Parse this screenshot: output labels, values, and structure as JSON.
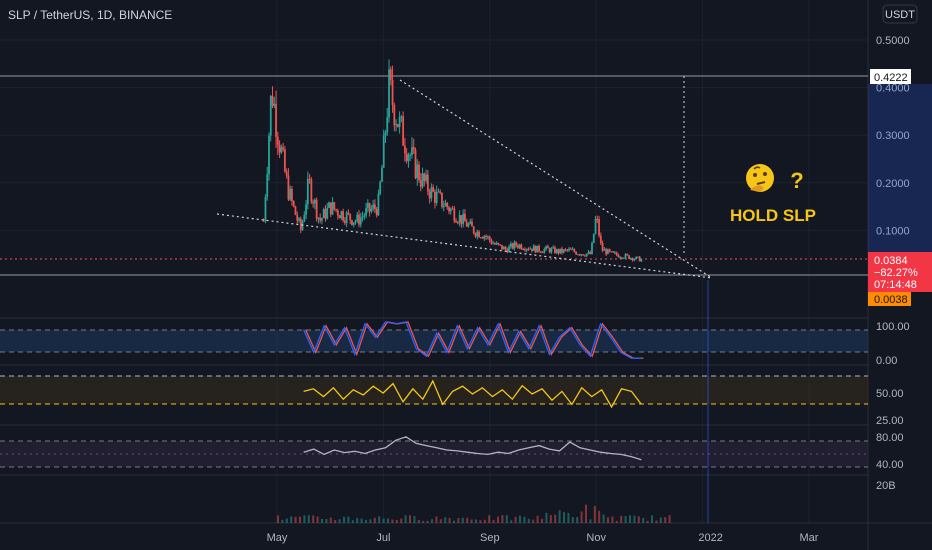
{
  "header": {
    "symbol": "SLP / TetherUS, 1D, BINANCE",
    "currency_button": "USDT"
  },
  "annotation": {
    "emoji_name": "thinking-face-icon",
    "question": "?",
    "text": "HOLD SLP"
  },
  "price_badges": {
    "high_level": "0.4222",
    "last_price": "0.0384",
    "change": "−82.27%",
    "countdown": "07:14:48",
    "low_level": "0.0038"
  },
  "colors": {
    "background": "#131722",
    "up": "#26a69a",
    "down": "#ef5350",
    "annotation": "#f5c518",
    "rsi_line": "#b2b5be",
    "stoch_k": "#2962ff",
    "stoch_d": "#ef5350",
    "osc_line": "#f5c518"
  },
  "chart_data": {
    "type": "candlestick",
    "symbol": "SLP/USDT",
    "interval": "1D",
    "x_tick_labels": [
      "May",
      "Jul",
      "Sep",
      "Nov",
      "2022",
      "Mar"
    ],
    "y_tick_labels": [
      "0.5000",
      "0.4000",
      "0.3000",
      "0.2000",
      "0.1000"
    ],
    "ylim": [
      -0.02,
      0.52
    ],
    "close_series": {
      "x_months": [
        4.75,
        4.9,
        5.0,
        5.1,
        5.2,
        5.3,
        5.45,
        5.6,
        5.8,
        6.0,
        6.15,
        6.3,
        6.5,
        6.7,
        6.9,
        7.0,
        7.1,
        7.3,
        7.5,
        7.7,
        7.9,
        8.1,
        8.3,
        8.5,
        8.7,
        8.9,
        9.1,
        9.3,
        9.5,
        9.7,
        9.9,
        10.1,
        10.3,
        10.5,
        10.7,
        10.9,
        11.0,
        11.1,
        11.3,
        11.5,
        11.7,
        11.85
      ],
      "close": [
        0.12,
        0.4,
        0.32,
        0.25,
        0.19,
        0.15,
        0.1,
        0.2,
        0.12,
        0.15,
        0.14,
        0.13,
        0.12,
        0.14,
        0.15,
        0.26,
        0.4,
        0.32,
        0.26,
        0.21,
        0.18,
        0.16,
        0.14,
        0.12,
        0.1,
        0.09,
        0.07,
        0.06,
        0.07,
        0.065,
        0.06,
        0.06,
        0.055,
        0.058,
        0.052,
        0.05,
        0.13,
        0.06,
        0.05,
        0.047,
        0.042,
        0.0384
      ]
    },
    "levels": {
      "high": 0.4222,
      "low": 0.0038
    },
    "indicators": [
      {
        "name": "stochastic",
        "y_tick_labels": [
          "100.00",
          "0.00"
        ],
        "bands": [
          80,
          20
        ],
        "values": [
          80,
          20,
          90,
          40,
          85,
          15,
          95,
          60,
          100,
          95,
          100,
          30,
          10,
          70,
          20,
          90,
          30,
          85,
          40,
          95,
          20,
          75,
          30,
          90,
          15,
          60,
          85,
          40,
          10,
          95,
          60,
          20,
          5,
          5
        ]
      },
      {
        "name": "oscillator",
        "y_tick_labels": [
          "50.00",
          "25.00"
        ],
        "bands": [
          70,
          30
        ],
        "values": [
          55,
          60,
          45,
          62,
          40,
          58,
          48,
          65,
          52,
          70,
          35,
          60,
          40,
          75,
          30,
          55,
          65,
          50,
          62,
          45,
          58,
          40,
          66,
          50,
          60,
          38,
          55,
          30,
          62,
          45,
          58,
          25,
          60,
          55,
          30
        ]
      },
      {
        "name": "rsi",
        "y_tick_labels": [
          "80.00",
          "40.00"
        ],
        "bands": [
          70,
          30
        ],
        "values": [
          45,
          52,
          40,
          50,
          44,
          47,
          42,
          50,
          55,
          72,
          80,
          65,
          60,
          55,
          50,
          48,
          45,
          42,
          40,
          45,
          42,
          50,
          55,
          60,
          52,
          48,
          68,
          55,
          50,
          45,
          42,
          40,
          35,
          28
        ]
      },
      {
        "name": "volume",
        "y_tick_labels": [
          "20B"
        ]
      }
    ]
  }
}
